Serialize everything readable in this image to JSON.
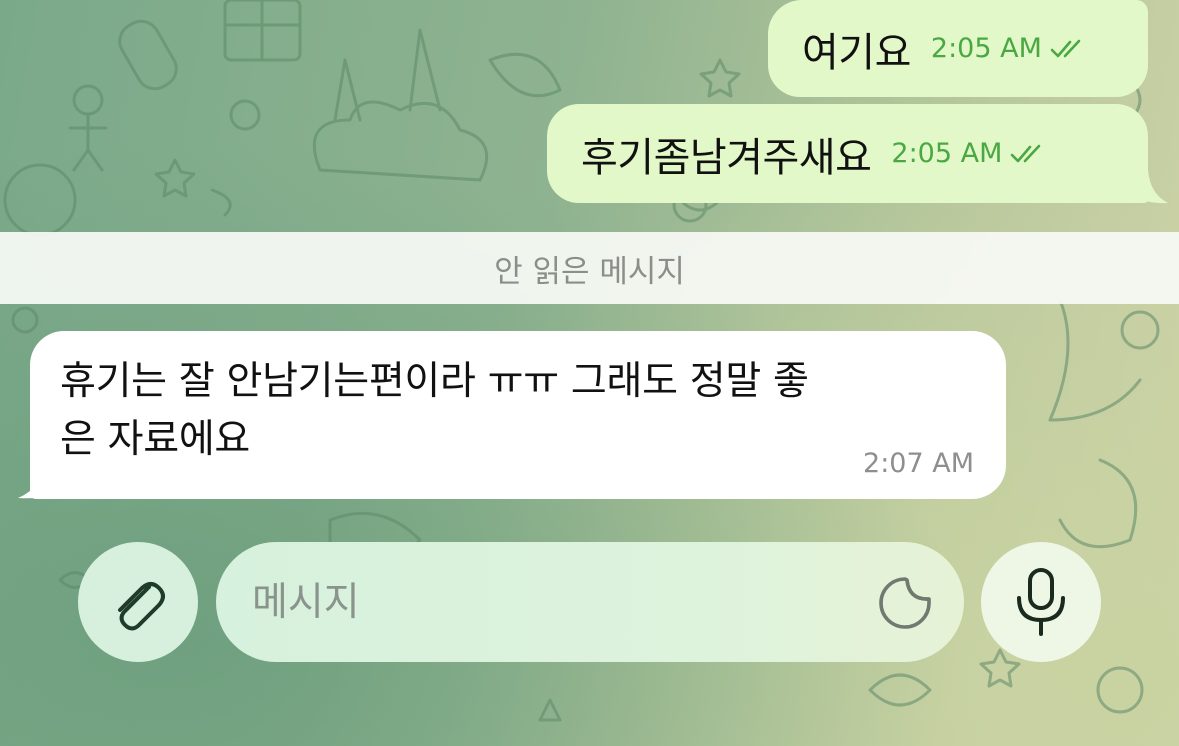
{
  "chat": {
    "outgoing": [
      {
        "text": "여기요",
        "time": "2:05 AM"
      },
      {
        "text": "후기좀남겨주새요",
        "time": "2:05 AM"
      }
    ],
    "unread_divider": "안 읽은 메시지",
    "incoming": [
      {
        "text": "휴기는 잘 안남기는편이라 ㅠㅠ 그래도 정말 좋\n은 자료에요",
        "time": "2:07 AM"
      }
    ]
  },
  "composer": {
    "placeholder": "메시지",
    "value": ""
  },
  "icons": {
    "attach": "paperclip-icon",
    "sticker": "sticker-icon",
    "mic": "microphone-icon",
    "read_status": "double-check-icon"
  },
  "colors": {
    "outgoing_bubble": "#e3f8c8",
    "incoming_bubble": "#ffffff",
    "read_check": "#4aa843"
  }
}
